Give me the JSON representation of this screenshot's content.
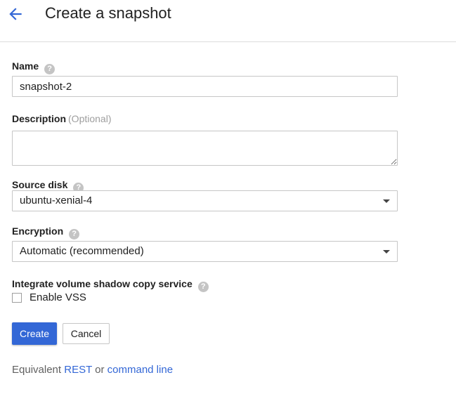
{
  "header": {
    "title": "Create a snapshot",
    "back_icon": "arrow-back-icon"
  },
  "accent_color": "#3367d6",
  "fields": {
    "name": {
      "label": "Name",
      "value": "snapshot-2"
    },
    "description": {
      "label": "Description",
      "optional": "(Optional)",
      "value": ""
    },
    "source_disk": {
      "label": "Source disk",
      "selected": "ubuntu-xenial-4"
    },
    "encryption": {
      "label": "Encryption",
      "selected": "Automatic (recommended)"
    },
    "vss": {
      "label": "Integrate volume shadow copy service",
      "checkbox_label": "Enable VSS",
      "checked": false
    }
  },
  "help_icon": "?",
  "buttons": {
    "create": "Create",
    "cancel": "Cancel"
  },
  "footer": {
    "prefix": "Equivalent",
    "rest_link": "REST",
    "conjunction": "or",
    "cli_link": "command line"
  }
}
